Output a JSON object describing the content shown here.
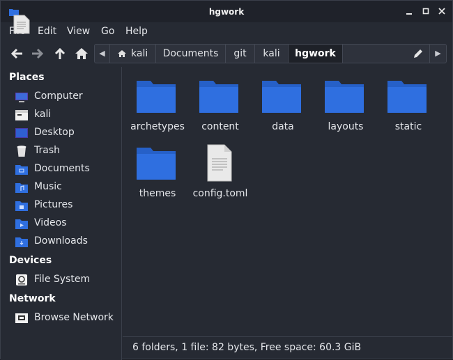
{
  "window": {
    "title": "hgwork"
  },
  "menu": {
    "file": "File",
    "edit": "Edit",
    "view": "View",
    "go": "Go",
    "help": "Help"
  },
  "path": {
    "crumbs": [
      "kali",
      "Documents",
      "git",
      "kali",
      "hgwork"
    ],
    "active_index": 4
  },
  "sidebar": {
    "places_heading": "Places",
    "places": [
      {
        "label": "Computer",
        "icon": "computer-icon"
      },
      {
        "label": "kali",
        "icon": "home-folder-icon"
      },
      {
        "label": "Desktop",
        "icon": "desktop-icon"
      },
      {
        "label": "Trash",
        "icon": "trash-icon"
      },
      {
        "label": "Documents",
        "icon": "documents-folder-icon"
      },
      {
        "label": "Music",
        "icon": "music-folder-icon"
      },
      {
        "label": "Pictures",
        "icon": "pictures-folder-icon"
      },
      {
        "label": "Videos",
        "icon": "videos-folder-icon"
      },
      {
        "label": "Downloads",
        "icon": "downloads-folder-icon"
      }
    ],
    "devices_heading": "Devices",
    "devices": [
      {
        "label": "File System",
        "icon": "drive-icon"
      }
    ],
    "network_heading": "Network",
    "network": [
      {
        "label": "Browse Network",
        "icon": "network-icon"
      }
    ]
  },
  "files": [
    {
      "name": "archetypes",
      "type": "folder"
    },
    {
      "name": "content",
      "type": "folder"
    },
    {
      "name": "data",
      "type": "folder"
    },
    {
      "name": "layouts",
      "type": "folder"
    },
    {
      "name": "static",
      "type": "folder"
    },
    {
      "name": "themes",
      "type": "folder"
    },
    {
      "name": "config.toml",
      "type": "file"
    }
  ],
  "status": {
    "text": "6 folders, 1 file: 82 bytes, Free space: 60.3 GiB"
  },
  "colors": {
    "folder": "#2f6fe0",
    "folder_tab": "#2660c8",
    "background": "#262a33",
    "active_crumb": "#1e2128"
  }
}
